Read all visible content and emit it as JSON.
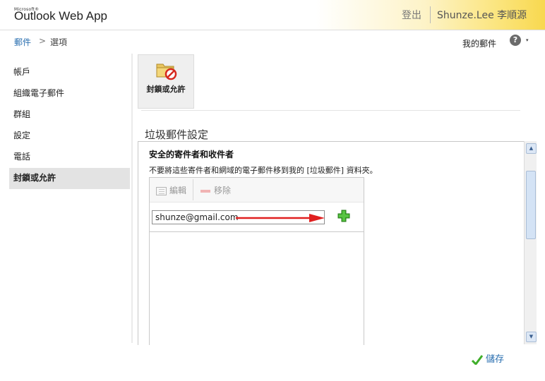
{
  "header": {
    "brand_small": "Microsoft®",
    "app_title": "Outlook Web App",
    "sign_out": "登出",
    "user_name": "Shunze.Lee 李順源"
  },
  "breadcrumb": {
    "mail": "郵件",
    "separator": ">",
    "options": "選項"
  },
  "top_right": {
    "my_mail": "我的郵件",
    "help": "?",
    "help_caret": "▾"
  },
  "left_nav": {
    "items": [
      {
        "label": "帳戶"
      },
      {
        "label": "組織電子郵件"
      },
      {
        "label": "群組"
      },
      {
        "label": "設定"
      },
      {
        "label": "電話"
      },
      {
        "label": "封鎖或允許"
      }
    ],
    "selected_index": 5
  },
  "toolbar": {
    "block_allow_label": "封鎖或允許",
    "block_allow_icon": "folder-block-icon"
  },
  "junk": {
    "section_title": "垃圾郵件設定",
    "safe_title": "安全的寄件者和收件者",
    "safe_description": "不要將這些寄件者和網域的電子郵件移到我的 [垃圾郵件] 資料夾。",
    "edit_label": "編輯",
    "remove_label": "移除",
    "entry_value": "shunze@gmail.com",
    "entry_placeholder": ""
  },
  "footer": {
    "save_label": "儲存"
  },
  "colors": {
    "link_blue": "#2a6fb0",
    "arrow_red": "#e01f1f",
    "add_green": "#3fae2a",
    "header_gold": "#f8d84f"
  }
}
